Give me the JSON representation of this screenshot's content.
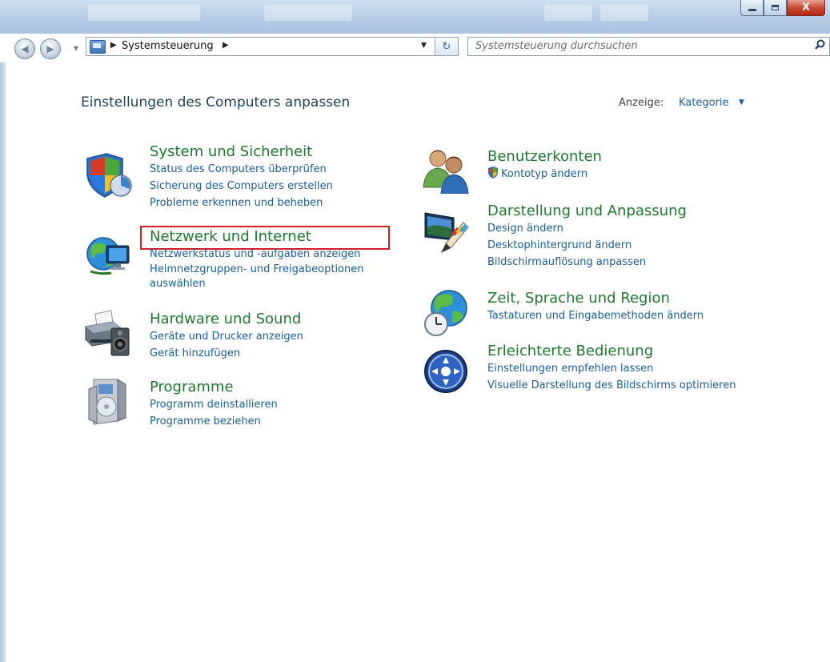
{
  "window": {
    "controls": {
      "minimize": "minimize",
      "maximize": "maximize",
      "close": "X"
    }
  },
  "address": {
    "crumb": "Systemsteuerung"
  },
  "search": {
    "placeholder": "Systemsteuerung durchsuchen"
  },
  "main": {
    "title": "Einstellungen des Computers anpassen",
    "view_label": "Anzeige:",
    "view_value": "Kategorie"
  },
  "categories_left": [
    {
      "title": "System und Sicherheit",
      "icon": "shield-icon",
      "links": [
        "Status des Computers überprüfen",
        "Sicherung des Computers erstellen",
        "Probleme erkennen und beheben"
      ]
    },
    {
      "title": "Netzwerk und Internet",
      "icon": "network-globe-icon",
      "links": [
        "Netzwerkstatus und -aufgaben anzeigen",
        "Heimnetzgruppen- und Freigabeoptionen auswählen"
      ]
    },
    {
      "title": "Hardware und Sound",
      "icon": "printer-speaker-icon",
      "links": [
        "Geräte und Drucker anzeigen",
        "Gerät hinzufügen"
      ]
    },
    {
      "title": "Programme",
      "icon": "programs-disc-icon",
      "links": [
        "Programm deinstallieren",
        "Programme beziehen"
      ]
    }
  ],
  "categories_right": [
    {
      "title": "Benutzerkonten",
      "icon": "users-icon",
      "links": [
        "Kontotyp ändern"
      ]
    },
    {
      "title": "Darstellung und Anpassung",
      "icon": "display-paint-icon",
      "links": [
        "Design ändern",
        "Desktophintergrund ändern",
        "Bildschirmauflösung anpassen"
      ]
    },
    {
      "title": "Zeit, Sprache und Region",
      "icon": "globe-clock-icon",
      "links": [
        "Tastaturen und Eingabemethoden ändern"
      ]
    },
    {
      "title": "Erleichterte Bedienung",
      "icon": "accessibility-icon",
      "links": [
        "Einstellungen empfehlen lassen",
        "Visuelle Darstellung des Bildschirms optimieren"
      ]
    }
  ],
  "colors": {
    "category_title": "#1e7b2e",
    "link": "#1a5fa0",
    "highlight": "#d21f26"
  }
}
